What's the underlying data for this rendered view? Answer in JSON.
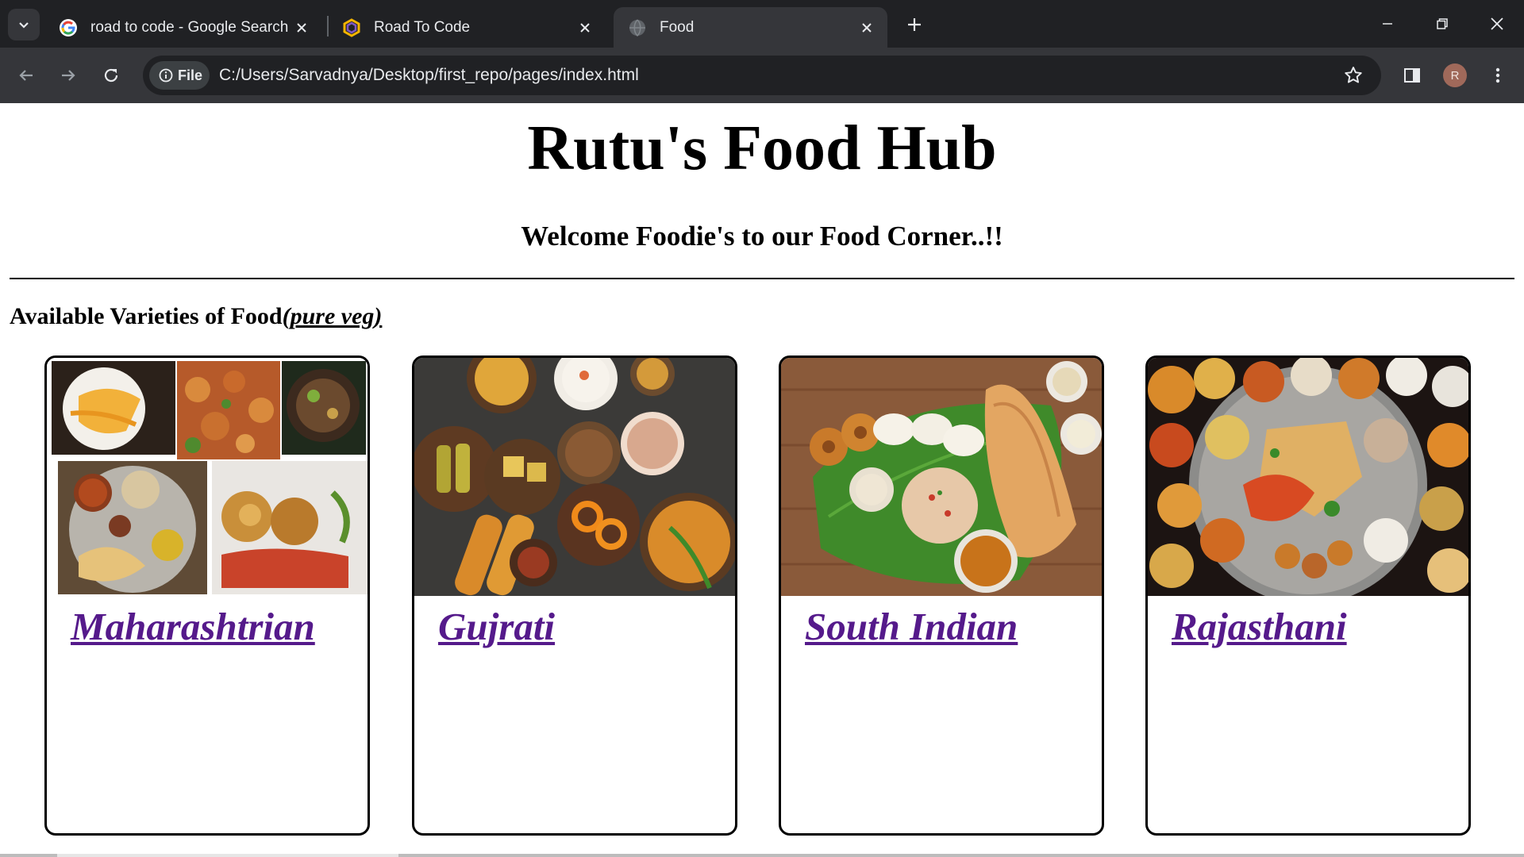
{
  "browser": {
    "tabs": [
      {
        "title": "road to code - Google Search",
        "favicon": "google-g-icon",
        "active": false
      },
      {
        "title": "Road To Code",
        "favicon": "hexagon-logo-icon",
        "active": false
      },
      {
        "title": "Food",
        "favicon": "globe-icon",
        "active": true
      }
    ],
    "address": {
      "chip": "File",
      "url": "C:/Users/Sarvadnya/Desktop/first_repo/pages/index.html"
    },
    "profile_initial": "R"
  },
  "page": {
    "title": "Rutu's Food Hub",
    "welcome": "Welcome Foodie's to our Food Corner..!!",
    "varieties_label": "Available Varieties of Food",
    "varieties_note": "(pure veg)",
    "cards": [
      {
        "name": "Maharashtrian"
      },
      {
        "name": "Gujrati"
      },
      {
        "name": "South Indian"
      },
      {
        "name": "Rajasthani"
      }
    ]
  },
  "colors": {
    "tab_strip": "#202124",
    "toolbar": "#35363a",
    "link_visited": "#551a8b"
  }
}
